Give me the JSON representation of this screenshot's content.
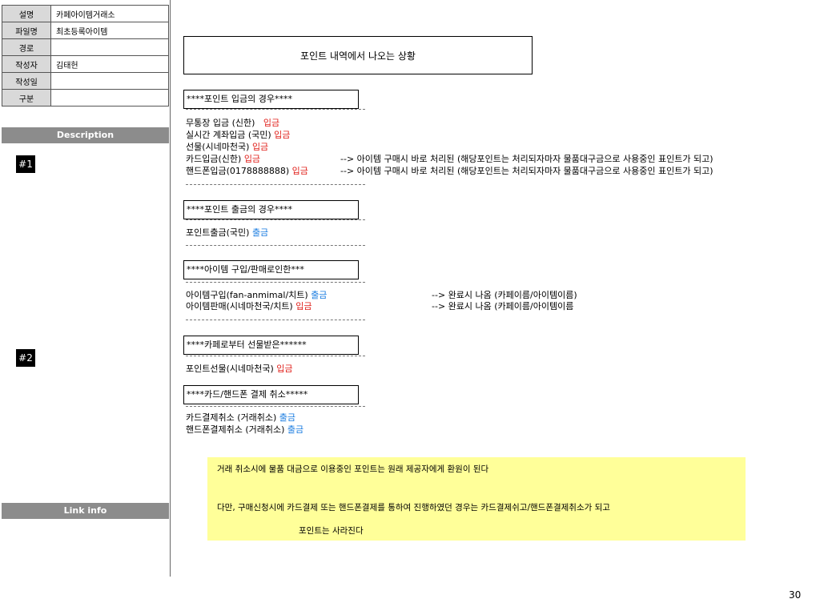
{
  "meta": [
    {
      "key": "설명",
      "value": "카페아이템거래소"
    },
    {
      "key": "파일명",
      "value": "최초등록아이템"
    },
    {
      "key": "경로",
      "value": ""
    },
    {
      "key": "작성자",
      "value": "김태헌"
    },
    {
      "key": "작성일",
      "value": ""
    },
    {
      "key": "구분",
      "value": ""
    }
  ],
  "sections": {
    "description": "Description",
    "link_info": "Link info"
  },
  "markers": [
    "#1",
    "#2"
  ],
  "title": "포인트 내역에서 나오는 상황",
  "deposit": {
    "header": "****포인트 입금의 경우****",
    "lines": [
      {
        "text": "무통장 입금 (신한)",
        "tag": "입금"
      },
      {
        "text": "실시간 계좌입금 (국민)",
        "tag": "입금"
      },
      {
        "text": "선물(시네마천국)",
        "tag": "입금"
      },
      {
        "text": "카드입금(신한)",
        "tag": "입금"
      },
      {
        "text": "핸드폰입금(0178888888)",
        "tag": "입금"
      }
    ],
    "notes": [
      "--> 아이템 구매시 바로 처리된 (해당포인트는 처리되자마자 물품대구금으로 사용중인 표인트가 되고)",
      "--> 아이템 구매시 바로 처리된 (해당포인트는 처리되자마자 물품대구금으로 사용중인 표인트가 되고)"
    ]
  },
  "withdraw": {
    "header": "****포인트 출금의 경우****",
    "lines": [
      {
        "text": "포인트출금(국민)",
        "tag": "출금"
      }
    ]
  },
  "item_trade": {
    "header": "****아이템 구입/판매로인한***",
    "lines": [
      {
        "text": "아이템구입(fan-anmimal/치트)",
        "tag": "출금"
      },
      {
        "text": "아이템판매(시네마천국/치트)",
        "tag": "입금"
      }
    ],
    "notes": [
      "--> 완료시 나옴 (카페이름/아이템이름)",
      "--> 완료시 나옴 (카페이름/아이템이름"
    ]
  },
  "gift": {
    "header": "****카페로부터 선물받은******",
    "lines": [
      {
        "text": "포인트선물(시네마천국)",
        "tag": "입금"
      }
    ]
  },
  "cancel": {
    "header": "****카드/핸드폰 결제 취소*****",
    "lines": [
      {
        "text": "카드결제취소 (거래취소)",
        "tag": "출금"
      },
      {
        "text": "핸드폰결제취소 (거래취소)",
        "tag": "출금"
      }
    ]
  },
  "yellow_note": {
    "line1": "거래 취소시에 물품 대금으로 이용중인 포인트는 원래 제공자에게 환원이 된다",
    "line2": "다만, 구매신청시에 카드결제 또는 핸드폰결제를 통하여 진행하였던 경우는 카드결제쉬고/핸드폰결제취소가 되고",
    "line3": "포인트는 사라진다"
  },
  "page_number": "30",
  "colors": {
    "in": "#e0201b",
    "out": "#1a7ce0",
    "note_bg": "#ffff99",
    "section_bar": "#8c8c8c"
  }
}
